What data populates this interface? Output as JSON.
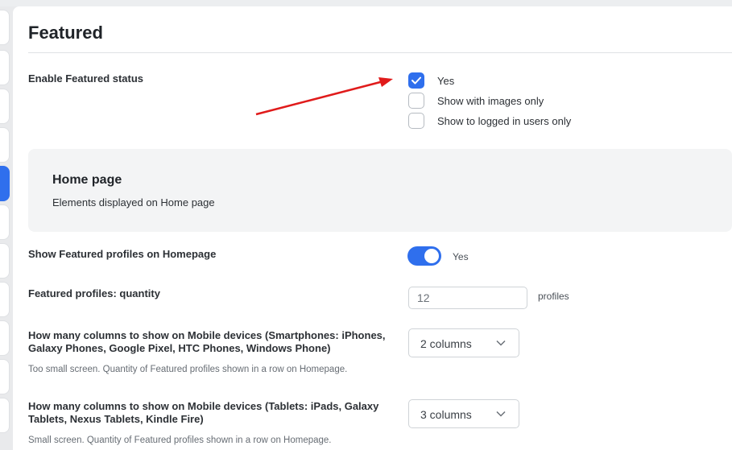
{
  "section_title": "Featured",
  "enable_featured": {
    "label": "Enable Featured status",
    "options": [
      {
        "label": "Yes",
        "checked": true
      },
      {
        "label": "Show with images only",
        "checked": false
      },
      {
        "label": "Show to logged in users only",
        "checked": false
      }
    ]
  },
  "home_card": {
    "title": "Home page",
    "subtitle": "Elements displayed on Home page"
  },
  "show_featured_home": {
    "label": "Show Featured profiles on Homepage",
    "value_label": "Yes",
    "on": true
  },
  "quantity": {
    "label": "Featured profiles: quantity",
    "value": "12",
    "suffix": "profiles"
  },
  "mobile_columns": {
    "label_line1": "How many columns to show on Mobile devices (Smartphones: iPhones,",
    "label_line2": "Galaxy Phones, Google Pixel, HTC Phones, Windows Phone)",
    "help": "Too small screen. Quantity of Featured profiles shown in a row on Homepage.",
    "selected": "2 columns"
  },
  "tablet_columns": {
    "label_line1": "How many columns to show on Mobile devices (Tablets: iPads, Galaxy",
    "label_line2": "Tablets, Nexus Tablets, Kindle Fire)",
    "help": "Small screen. Quantity of Featured profiles shown in a row on Homepage.",
    "selected": "3 columns"
  },
  "colors": {
    "accent": "#2f6fed",
    "annotation_arrow": "#e01b1b"
  }
}
